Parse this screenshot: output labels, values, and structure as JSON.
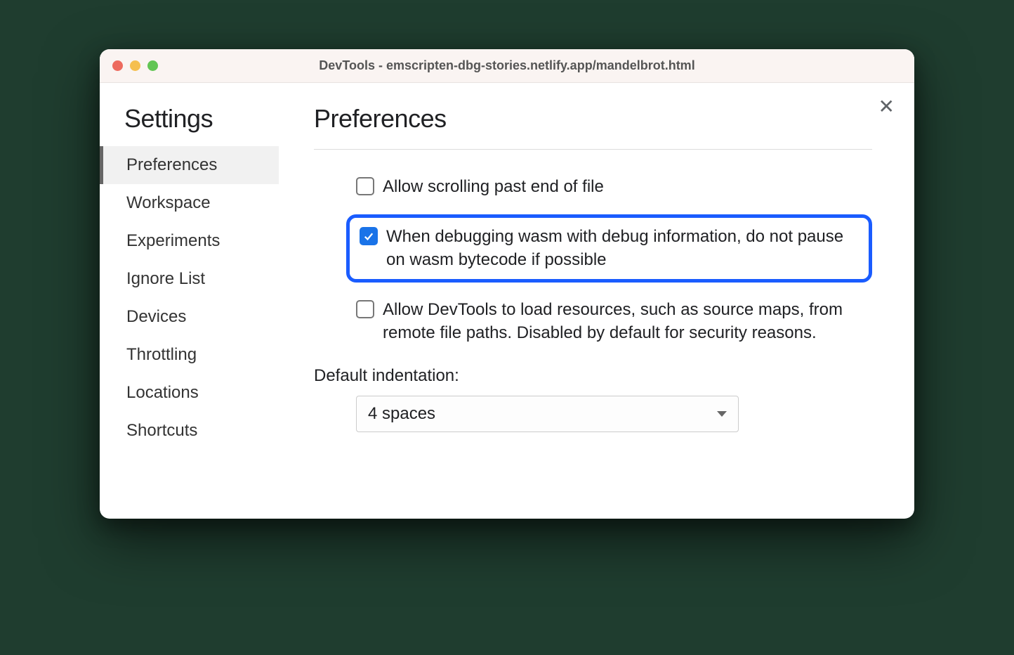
{
  "window": {
    "title": "DevTools - emscripten-dbg-stories.netlify.app/mandelbrot.html"
  },
  "sidebar": {
    "title": "Settings",
    "items": [
      {
        "label": "Preferences",
        "active": true
      },
      {
        "label": "Workspace",
        "active": false
      },
      {
        "label": "Experiments",
        "active": false
      },
      {
        "label": "Ignore List",
        "active": false
      },
      {
        "label": "Devices",
        "active": false
      },
      {
        "label": "Throttling",
        "active": false
      },
      {
        "label": "Locations",
        "active": false
      },
      {
        "label": "Shortcuts",
        "active": false
      }
    ]
  },
  "main": {
    "title": "Preferences",
    "options": [
      {
        "label": "Allow scrolling past end of file",
        "checked": false,
        "highlighted": false
      },
      {
        "label": "When debugging wasm with debug information, do not pause on wasm bytecode if possible",
        "checked": true,
        "highlighted": true
      },
      {
        "label": "Allow DevTools to load resources, such as source maps, from remote file paths. Disabled by default for security reasons.",
        "checked": false,
        "highlighted": false
      }
    ],
    "indentation": {
      "label": "Default indentation:",
      "value": "4 spaces"
    }
  }
}
